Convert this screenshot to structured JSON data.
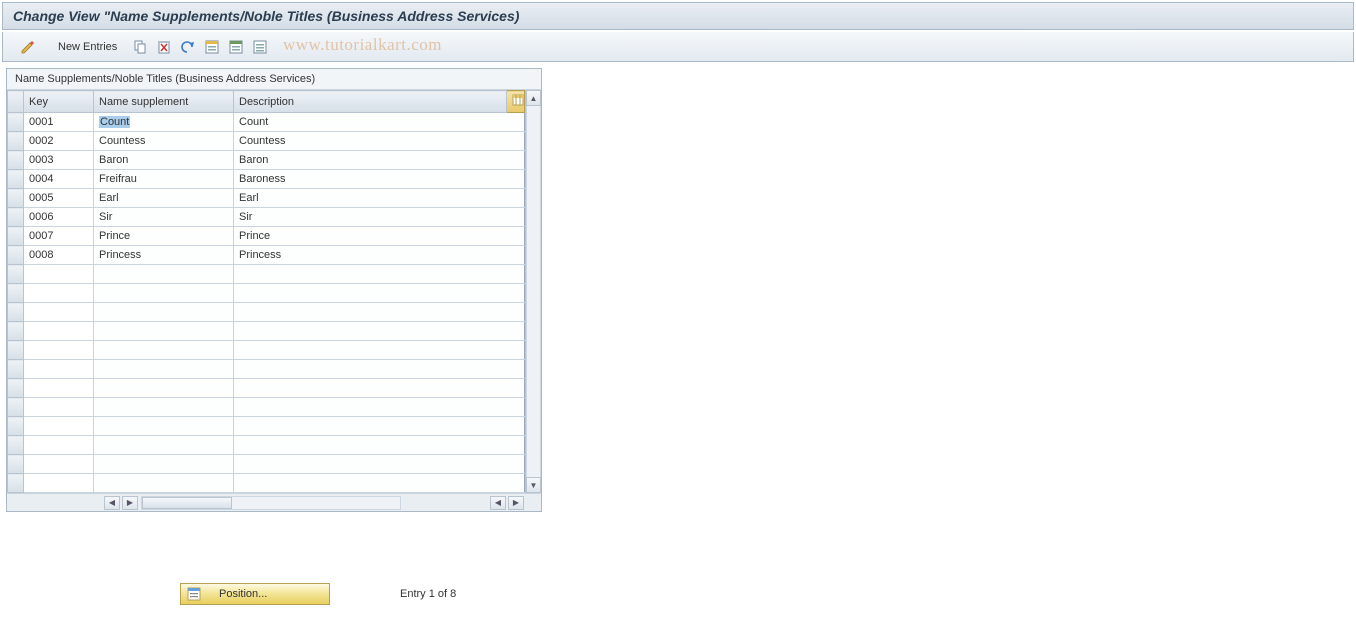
{
  "title": "Change View \"Name Supplements/Noble Titles (Business Address Services)",
  "toolbar": {
    "new_entries": "New Entries"
  },
  "watermark": "www.tutorialkart.com",
  "grid": {
    "caption": "Name Supplements/Noble Titles (Business Address Services)",
    "columns": {
      "key": "Key",
      "supplement": "Name supplement",
      "description": "Description"
    },
    "rows": [
      {
        "key": "0001",
        "supplement": "Count",
        "description": "Count",
        "selected": true
      },
      {
        "key": "0002",
        "supplement": "Countess",
        "description": "Countess"
      },
      {
        "key": "0003",
        "supplement": "Baron",
        "description": "Baron"
      },
      {
        "key": "0004",
        "supplement": "Freifrau",
        "description": "Baroness"
      },
      {
        "key": "0005",
        "supplement": "Earl",
        "description": "Earl"
      },
      {
        "key": "0006",
        "supplement": "Sir",
        "description": "Sir"
      },
      {
        "key": "0007",
        "supplement": "Prince",
        "description": "Prince"
      },
      {
        "key": "0008",
        "supplement": "Princess",
        "description": "Princess"
      }
    ],
    "empty_rows": 12
  },
  "footer": {
    "position_label": "Position...",
    "entry_text": "Entry 1 of 8"
  }
}
